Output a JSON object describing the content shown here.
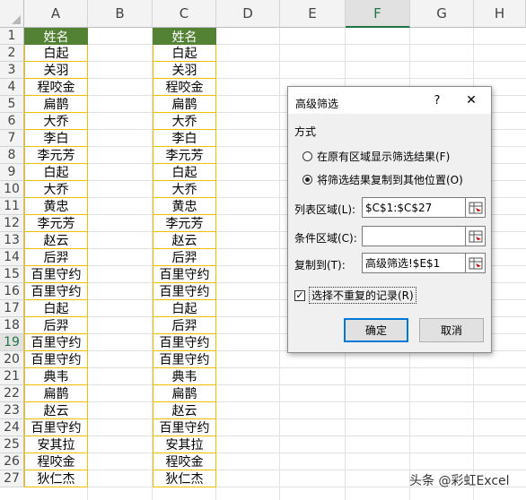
{
  "columns": [
    "A",
    "B",
    "C",
    "D",
    "E",
    "F",
    "G",
    "H"
  ],
  "active_column": "F",
  "row_numbers": [
    "1",
    "2",
    "3",
    "4",
    "5",
    "6",
    "7",
    "8",
    "9",
    "10",
    "11",
    "12",
    "13",
    "14",
    "15",
    "16",
    "17",
    "18",
    "19",
    "20",
    "21",
    "22",
    "23",
    "24",
    "25",
    "26",
    "27"
  ],
  "active_row": "19",
  "column_a": {
    "header": "姓名",
    "values": [
      "白起",
      "关羽",
      "程咬金",
      "扁鹊",
      "大乔",
      "李白",
      "李元芳",
      "白起",
      "大乔",
      "黄忠",
      "李元芳",
      "赵云",
      "后羿",
      "百里守约",
      "百里守约",
      "白起",
      "后羿",
      "百里守约",
      "百里守约",
      "典韦",
      "扁鹊",
      "赵云",
      "百里守约",
      "安其拉",
      "程咬金",
      "狄仁杰"
    ]
  },
  "column_c": {
    "header": "姓名",
    "values": [
      "白起",
      "关羽",
      "程咬金",
      "扁鹊",
      "大乔",
      "李白",
      "李元芳",
      "白起",
      "大乔",
      "黄忠",
      "李元芳",
      "赵云",
      "后羿",
      "百里守约",
      "百里守约",
      "白起",
      "后羿",
      "百里守约",
      "百里守约",
      "典韦",
      "扁鹊",
      "赵云",
      "百里守约",
      "安其拉",
      "程咬金",
      "狄仁杰"
    ]
  },
  "dialog": {
    "title": "高级筛选",
    "help": "?",
    "close": "✕",
    "section": "方式",
    "option1": "在原有区域显示筛选结果(F)",
    "option2": "将筛选结果复制到其他位置(O)",
    "list_label": "列表区域(L):",
    "list_value": "$C$1:$C$27",
    "criteria_label": "条件区域(C):",
    "criteria_value": "",
    "copyto_label": "复制到(T):",
    "copyto_value": "高级筛选!$E$1",
    "unique_label": "选择不重复的记录(R)",
    "unique_checked": true,
    "ok": "确定",
    "cancel": "取消"
  },
  "watermark": "头条 @彩虹Excel"
}
